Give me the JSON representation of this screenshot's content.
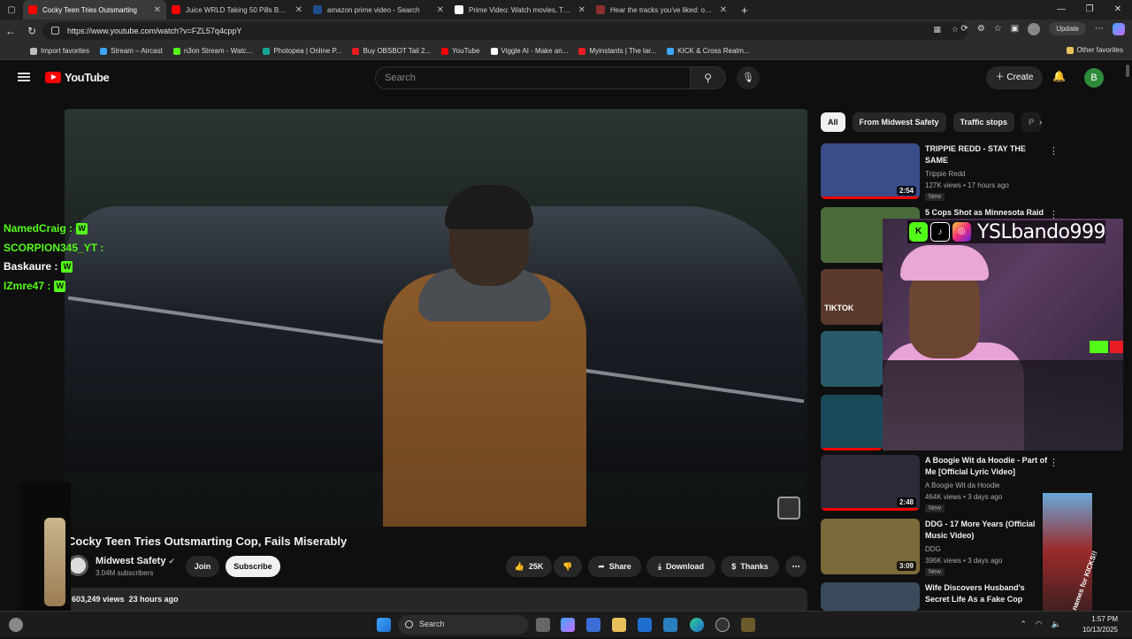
{
  "browser": {
    "tabs": [
      {
        "title": "Cocky Teen Tries Outsmarting",
        "color": "#ff0000",
        "active": true
      },
      {
        "title": "Juice WRLD Taking 50 Pills Becau",
        "color": "#ff0000",
        "active": false
      },
      {
        "title": "amazon prime video - Search",
        "color": "#1f4e8c",
        "active": false
      },
      {
        "title": "Prime Video: Watch movies, TV s",
        "color": "#ffffff",
        "active": false
      },
      {
        "title": "Hear the tracks you've liked: on S",
        "color": "#8b2e2e",
        "active": false
      }
    ],
    "new_tab": "+",
    "url": "https://www.youtube.com/watch?v=FZL57q4cppY",
    "update_label": "Update",
    "bookmarks": [
      {
        "label": "Import favorites",
        "color": "#bbbbbb"
      },
      {
        "label": "Stream – Aircast",
        "color": "#3ea6ff"
      },
      {
        "label": "n3on Stream - Watc...",
        "color": "#53fc18"
      },
      {
        "label": "Photopea | Online P...",
        "color": "#18a497"
      },
      {
        "label": "Buy OBSBOT Tail 2...",
        "color": "#e91c24"
      },
      {
        "label": "YouTube",
        "color": "#ff0000"
      },
      {
        "label": "Viggle AI - Make an...",
        "color": "#ffffff"
      },
      {
        "label": "Myinstants | The lar...",
        "color": "#e91c24"
      },
      {
        "label": "KICK & Cross Realm...",
        "color": "#3ea6ff"
      }
    ],
    "other_favorites": "Other favorites"
  },
  "youtube": {
    "logo_text": "YouTube",
    "search_placeholder": "Search",
    "create_label": "Create",
    "avatar_letter": "B"
  },
  "video": {
    "title": "Cocky Teen Tries Outsmarting Cop, Fails Miserably",
    "channel": "Midwest Safety",
    "subscribers": "3.04M subscribers",
    "join_label": "Join",
    "subscribe_label": "Subscribe",
    "likes": "25K",
    "share_label": "Share",
    "download_label": "Download",
    "thanks_label": "Thanks",
    "views": "603,249 views",
    "age": "23 hours ago"
  },
  "chat": [
    {
      "name": "NamedCraig :",
      "color": "#53fc18",
      "badge": "W"
    },
    {
      "name": "SCORPION345_YT :",
      "color": "#53fc18",
      "badge": ""
    },
    {
      "name": "Baskaure :",
      "color": "#ffffff",
      "badge": "W"
    },
    {
      "name": "IZmre47 :",
      "color": "#53fc18",
      "badge": "W"
    }
  ],
  "chips": [
    "All",
    "From Midwest Safety",
    "Traffic stops",
    "P"
  ],
  "recommendations": [
    {
      "title": "TRIPPIE REDD - STAY THE SAME",
      "channel": "Trippie Redd",
      "meta": "127K views • 17 hours ago",
      "badge": "New",
      "duration": "2:54",
      "thumb": "#3b4c8a"
    },
    {
      "title": "5 Cops Shot as Minnesota Raid",
      "channel": "",
      "meta": "",
      "badge": "",
      "duration": "",
      "thumb": "#4a6a3a"
    },
    {
      "title": "",
      "channel": "",
      "meta": "",
      "badge": "",
      "duration": "",
      "thumb": "#5a3a2a",
      "caption": "TIKTOK"
    },
    {
      "title": "",
      "channel": "",
      "meta": "",
      "badge": "",
      "duration": "",
      "thumb": "#2a5a6a"
    },
    {
      "title": "",
      "channel": "",
      "meta": "",
      "badge": "",
      "duration": "",
      "thumb": "#1a4a5a"
    },
    {
      "title": "A Boogie Wit da Hoodie - Part of Me [Official Lyric Video]",
      "channel": "A Boogie Wit da Hoodie",
      "meta": "464K views • 3 days ago",
      "badge": "New",
      "duration": "2:48",
      "thumb": "#2a2a3a"
    },
    {
      "title": "DDG - 17 More Years (Official Music Video)",
      "channel": "DDG",
      "meta": "396K views • 3 days ago",
      "badge": "New",
      "duration": "3:09",
      "thumb": "#7a6a3a"
    },
    {
      "title": "Wife Discovers Husband's Secret Life As a Fake Cop",
      "channel": "",
      "meta": "",
      "badge": "",
      "duration": "",
      "thumb": "#3a4a5a"
    }
  ],
  "stream_overlay": {
    "handle": "YSLbando999",
    "sticker_text": "Y'all got names for KICKS!!"
  },
  "taskbar": {
    "search_label": "Search",
    "time": "1:57 PM",
    "date": "10/13/2025"
  }
}
